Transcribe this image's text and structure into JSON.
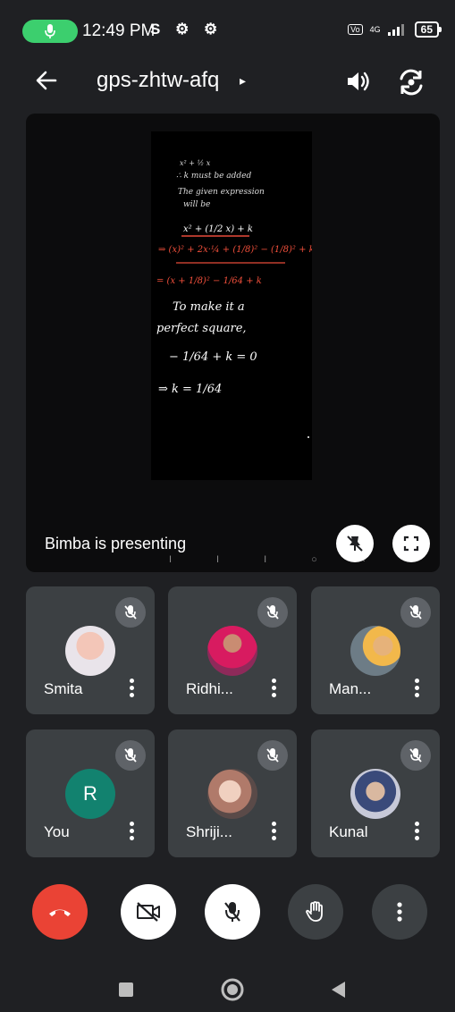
{
  "status_bar": {
    "time": "12:49 PM",
    "left_icons": "S",
    "network": "4G",
    "battery": "65"
  },
  "header": {
    "meeting_code": "gps-zhtw-afq",
    "arrow": "▸"
  },
  "presentation": {
    "presenter_text": "Bimba is presenting",
    "handwriting": [
      "x² + ½ x",
      "∴ k must be added",
      "The given expression",
      "will be",
      "x² + (1/2 x) + k",
      "⇒ (x)² + 2x·¼ + (1/8)² − (1/8)² + k",
      "= (x + 1/8)² − 1/64 + k",
      "To make it a",
      "perfect square,",
      "− 1/64 + k = 0",
      "⇒  k = 1/64"
    ]
  },
  "participants": [
    {
      "name": "Smita"
    },
    {
      "name": "Ridhi..."
    },
    {
      "name": "Man..."
    },
    {
      "name": "You",
      "initial": "R"
    },
    {
      "name": "Shriji..."
    },
    {
      "name": "Kunal"
    }
  ],
  "colors": {
    "end_call": "#ea4335",
    "tile_bg": "#3c4043",
    "background": "#1f2023",
    "you_avatar": "#12826f"
  },
  "icons": [
    "mic-icon",
    "back-arrow-icon",
    "volume-icon",
    "camera-flip-icon",
    "unpin-icon",
    "fullscreen-icon",
    "mic-off-icon",
    "more-vert-icon",
    "end-call-icon",
    "camera-off-icon",
    "raise-hand-icon",
    "square-icon",
    "circle-icon",
    "triangle-back-icon"
  ]
}
